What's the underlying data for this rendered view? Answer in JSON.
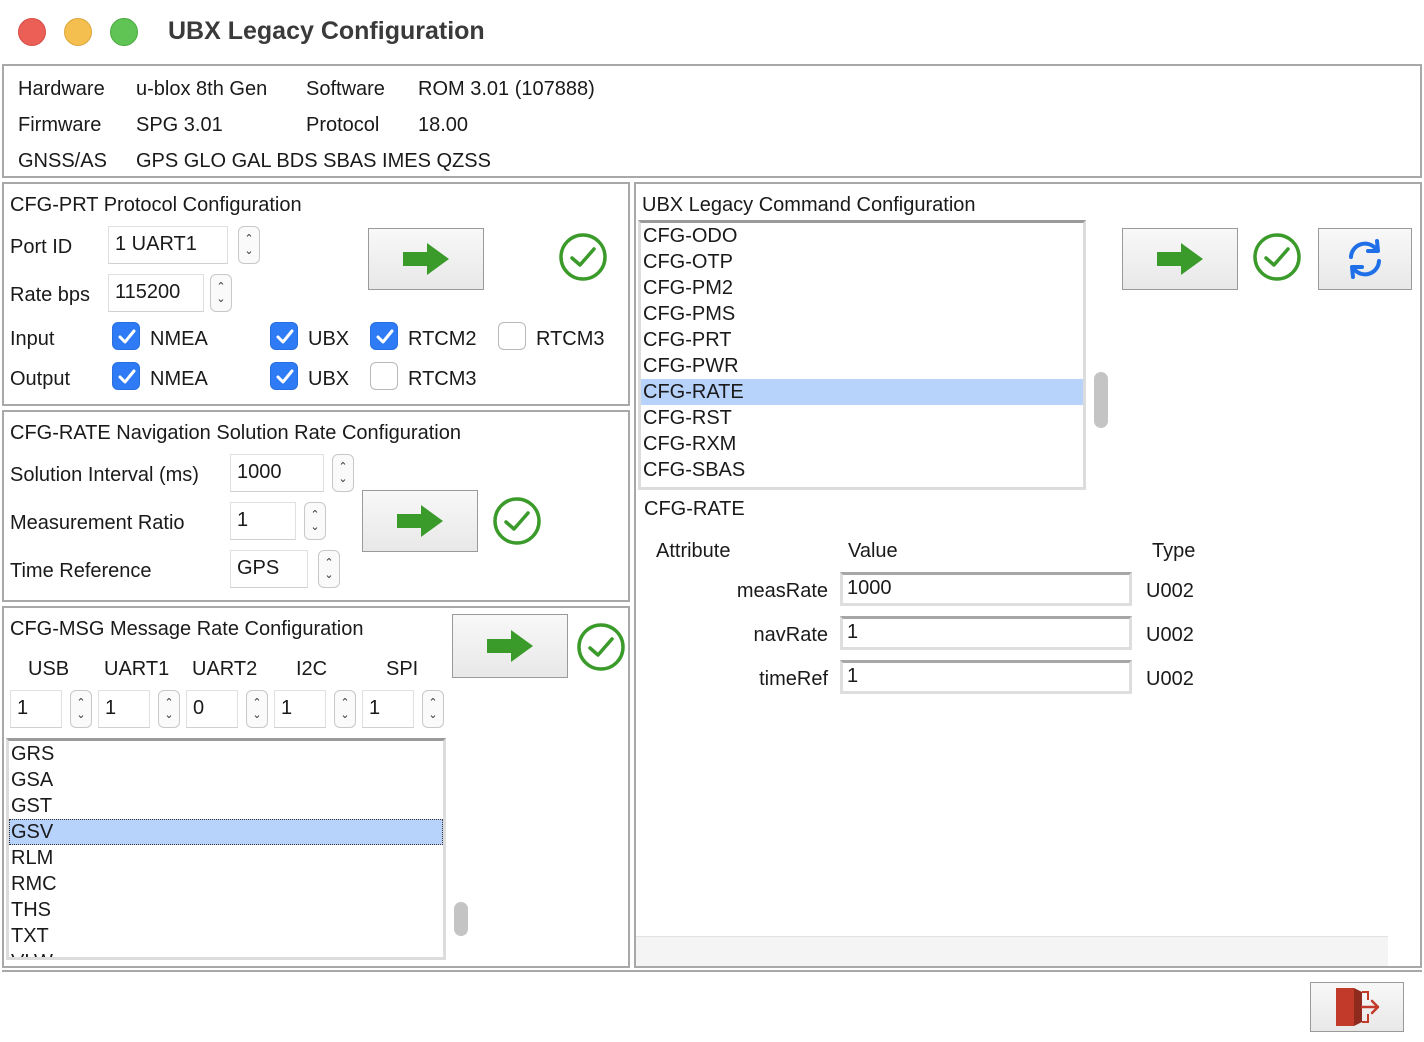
{
  "window": {
    "title": "UBX Legacy Configuration"
  },
  "info": {
    "hardware_label": "Hardware",
    "hardware_value": "u-blox 8th Gen",
    "software_label": "Software",
    "software_value": "ROM 3.01 (107888)",
    "firmware_label": "Firmware",
    "firmware_value": "SPG 3.01",
    "protocol_label": "Protocol",
    "protocol_value": "18.00",
    "gnss_label": "GNSS/AS",
    "gnss_value": "GPS GLO GAL BDS SBAS IMES QZSS"
  },
  "prt": {
    "title": "CFG-PRT Protocol Configuration",
    "port_label": "Port ID",
    "port_value": "1 UART1",
    "rate_label": "Rate bps",
    "rate_value": "115200",
    "input_label": "Input",
    "output_label": "Output",
    "input": {
      "nmea": {
        "label": "NMEA",
        "checked": true
      },
      "ubx": {
        "label": "UBX",
        "checked": true
      },
      "rtcm2": {
        "label": "RTCM2",
        "checked": true
      },
      "rtcm3": {
        "label": "RTCM3",
        "checked": false
      }
    },
    "output": {
      "nmea": {
        "label": "NMEA",
        "checked": true
      },
      "ubx": {
        "label": "UBX",
        "checked": true
      },
      "rtcm3": {
        "label": "RTCM3",
        "checked": false
      }
    }
  },
  "rate": {
    "title": "CFG-RATE Navigation Solution Rate Configuration",
    "interval_label": "Solution Interval (ms)",
    "interval_value": "1000",
    "ratio_label": "Measurement Ratio",
    "ratio_value": "1",
    "timeref_label": "Time Reference",
    "timeref_value": "GPS"
  },
  "msg": {
    "title": "CFG-MSG Message Rate Configuration",
    "ports": [
      {
        "label": "USB",
        "value": "1"
      },
      {
        "label": "UART1",
        "value": "1"
      },
      {
        "label": "UART2",
        "value": "0"
      },
      {
        "label": "I2C",
        "value": "1"
      },
      {
        "label": "SPI",
        "value": "1"
      }
    ],
    "messages": [
      "GRS",
      "GSA",
      "GST",
      "GSV",
      "RLM",
      "RMC",
      "THS",
      "TXT",
      "VLW"
    ],
    "selected": "GSV"
  },
  "cmd": {
    "title": "UBX Legacy Command Configuration",
    "commands": [
      "CFG-ODO",
      "CFG-OTP",
      "CFG-PM2",
      "CFG-PMS",
      "CFG-PRT",
      "CFG-PWR",
      "CFG-RATE",
      "CFG-RST",
      "CFG-RXM",
      "CFG-SBAS"
    ],
    "selected": "CFG-RATE",
    "detail_title": "CFG-RATE",
    "col_attribute": "Attribute",
    "col_value": "Value",
    "col_type": "Type",
    "rows": [
      {
        "attr": "measRate",
        "value": "1000",
        "type": "U002"
      },
      {
        "attr": "navRate",
        "value": "1",
        "type": "U002"
      },
      {
        "attr": "timeRef",
        "value": "1",
        "type": "U002"
      }
    ]
  },
  "icons": {
    "send": "green-right-arrow-icon",
    "confirm": "green-check-circle-icon",
    "refresh": "blue-refresh-icon",
    "exit": "red-exit-door-icon"
  },
  "colors": {
    "arrow": "#3a9a2a",
    "check": "#3a9a2a",
    "refresh": "#1f6fe8",
    "selection": "#b7d2fb",
    "checkbox": "#2f7bf5",
    "exit": "#c23a2a"
  }
}
